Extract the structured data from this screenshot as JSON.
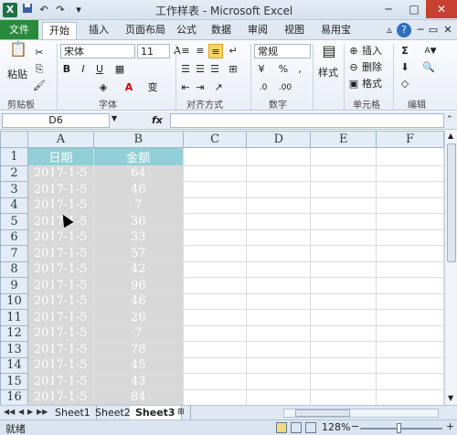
{
  "window": {
    "title": "工作样表 - Microsoft Excel"
  },
  "quick_access": {
    "undo": "↶",
    "redo": "↷",
    "customize": "▾"
  },
  "tabs": [
    {
      "label": "文件"
    },
    {
      "label": "开始"
    },
    {
      "label": "插入"
    },
    {
      "label": "页面布局"
    },
    {
      "label": "公式"
    },
    {
      "label": "数据"
    },
    {
      "label": "审阅"
    },
    {
      "label": "视图"
    },
    {
      "label": "易用宝"
    }
  ],
  "ribbon": {
    "paste_label": "粘贴",
    "font_name": "宋体",
    "font_size": "11",
    "font_buttons": {
      "bold": "B",
      "italic": "I",
      "underline": "U",
      "font_color": "A",
      "pinyin": "变"
    },
    "number_format": "常规",
    "number_buttons": {
      "percent": "%",
      "comma": ","
    },
    "style_label": "样式",
    "cell_buttons": {
      "insert": "插入",
      "delete": "删除",
      "format": "格式"
    },
    "edit_buttons": {
      "sum": "Σ",
      "sort": "A▼"
    },
    "groups": {
      "clipboard": "剪贴板",
      "font": "字体",
      "alignment": "对齐方式",
      "number": "数字",
      "cells": "单元格",
      "editing": "编辑"
    }
  },
  "formula_bar": {
    "name_box": "D6",
    "fx": "fx",
    "value": ""
  },
  "grid": {
    "columns": [
      "A",
      "B",
      "C",
      "D",
      "E",
      "F"
    ],
    "header_row": [
      "日期",
      "金额"
    ],
    "rows": [
      {
        "n": "1",
        "date": "",
        "amount": ""
      },
      {
        "n": "2",
        "date": "2017-1-5",
        "amount": "64"
      },
      {
        "n": "3",
        "date": "2017-1-5",
        "amount": "46"
      },
      {
        "n": "4",
        "date": "2017-1-5",
        "amount": "7"
      },
      {
        "n": "5",
        "date": "2017-1-5",
        "amount": "36"
      },
      {
        "n": "6",
        "date": "2017-1-5",
        "amount": "33"
      },
      {
        "n": "7",
        "date": "2017-1-5",
        "amount": "57"
      },
      {
        "n": "8",
        "date": "2017-1-5",
        "amount": "42"
      },
      {
        "n": "9",
        "date": "2017-1-5",
        "amount": "96"
      },
      {
        "n": "10",
        "date": "2017-1-5",
        "amount": "46"
      },
      {
        "n": "11",
        "date": "2017-1-5",
        "amount": "26"
      },
      {
        "n": "12",
        "date": "2017-1-5",
        "amount": "7"
      },
      {
        "n": "13",
        "date": "2017-1-5",
        "amount": "78"
      },
      {
        "n": "14",
        "date": "2017-1-5",
        "amount": "45"
      },
      {
        "n": "15",
        "date": "2017-1-5",
        "amount": "43"
      },
      {
        "n": "16",
        "date": "2017-1-5",
        "amount": "84"
      }
    ]
  },
  "sheets": [
    {
      "label": "Sheet1"
    },
    {
      "label": "Sheet2"
    },
    {
      "label": "Sheet3"
    }
  ],
  "active_sheet": "Sheet3",
  "status": {
    "text": "就绪",
    "zoom": "128%"
  },
  "colors": {
    "header_fill": "#91cfd6",
    "data_fill": "#d8d8d8",
    "file_tab": "#2a8a3c"
  }
}
